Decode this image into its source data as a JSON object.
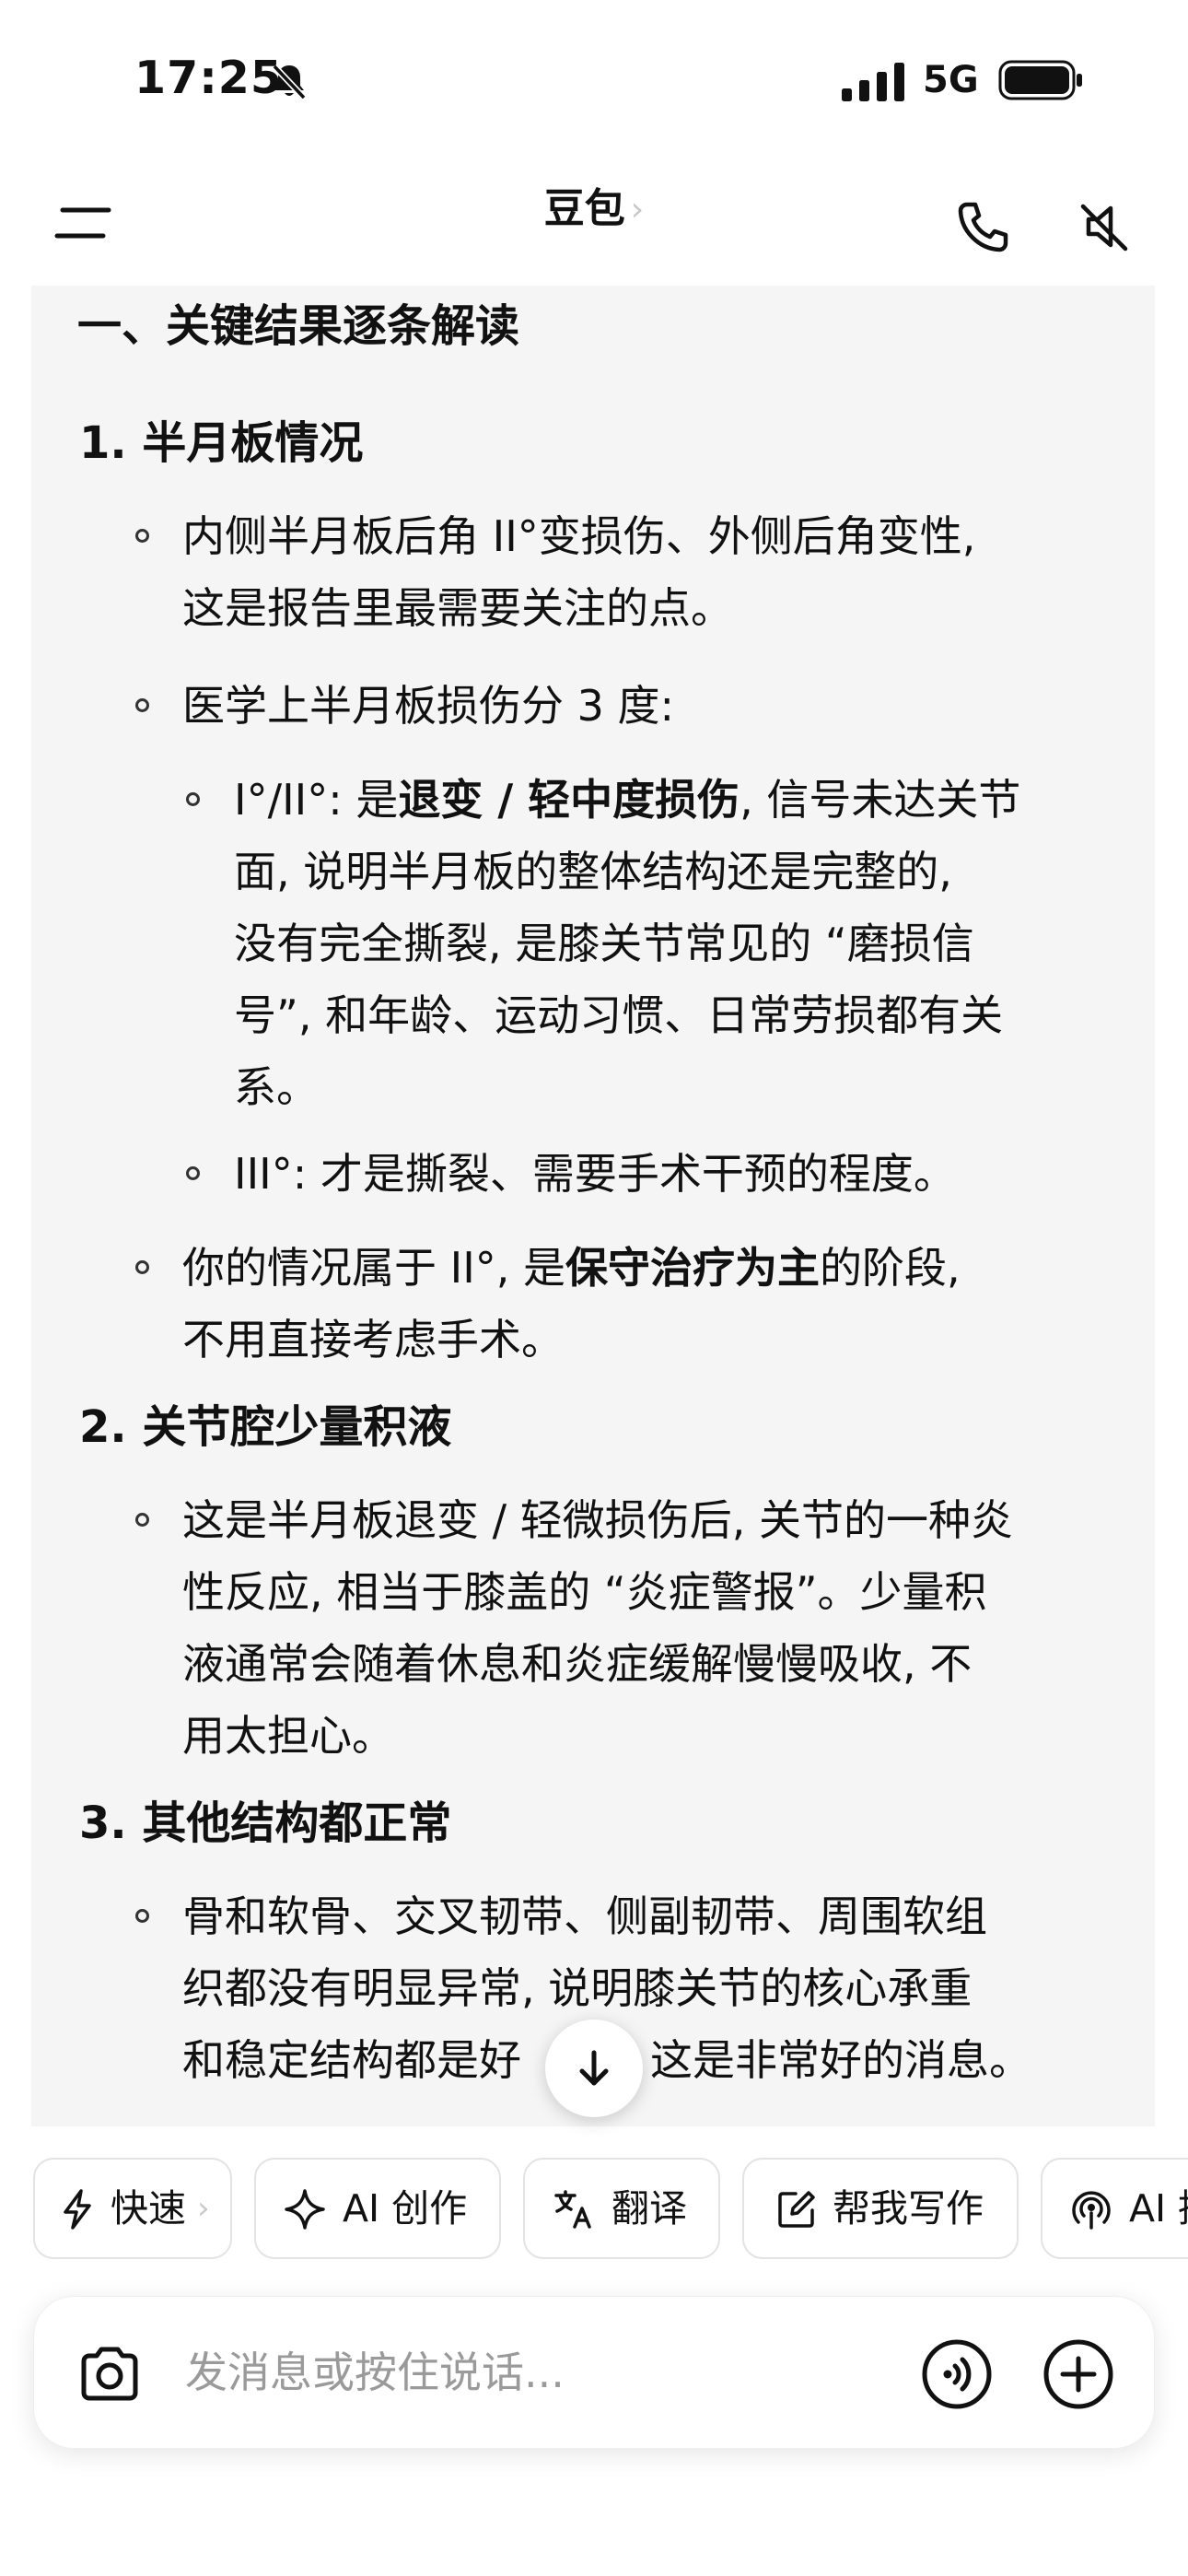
{
  "status_bar": {
    "time": "17:25",
    "network": "5G"
  },
  "header": {
    "title": "豆包",
    "title_chevron": "›"
  },
  "icons": {
    "bell_off": "bell-slash-icon",
    "signal": "cellular-signal-icon",
    "battery": "battery-icon",
    "menu": "menu-icon",
    "phone": "phone-icon",
    "mute": "speaker-mute-icon",
    "scroll_down": "arrow-down-icon",
    "camera": "camera-icon",
    "voice": "voice-call-icon",
    "plus": "plus-circle-icon"
  },
  "message": {
    "heading": "一、关键结果逐条解读",
    "s1": {
      "title": "1. 半月板情况",
      "p1_l1": "内侧半月板后角 II°变损伤、外侧后角变性,",
      "p1_l2": "这是报告里最需要关注的点。",
      "p2": "医学上半月板损伤分 3 度:",
      "sub1_l1_a": "I°/II°: 是",
      "sub1_l1_b": "退变 / 轻中度损伤",
      "sub1_l1_c": ", 信号未达关节",
      "sub1_l2": "面, 说明半月板的整体结构还是完整的,",
      "sub1_l3": "没有完全撕裂, 是膝关节常见的 “磨损信",
      "sub1_l4": "号”, 和年龄、运动习惯、日常劳损都有关",
      "sub1_l5": "系。",
      "sub2": "III°: 才是撕裂、需要手术干预的程度。",
      "p3_l1_a": "你的情况属于 II°, 是",
      "p3_l1_b": "保守治疗为主",
      "p3_l1_c": "的阶段,",
      "p3_l2": "不用直接考虑手术。"
    },
    "s2": {
      "title": "2. 关节腔少量积液",
      "l1": "这是半月板退变 / 轻微损伤后, 关节的一种炎",
      "l2": "性反应, 相当于膝盖的 “炎症警报”。少量积",
      "l3": "液通常会随着休息和炎症缓解慢慢吸收, 不",
      "l4": "用太担心。"
    },
    "s3": {
      "title": "3. 其他结构都正常",
      "l1": "骨和软骨、交叉韧带、侧副韧带、周围软组",
      "l2": "织都没有明显异常, 说明膝关节的核心承重",
      "l3_a": "和稳定结构都是好",
      "l3_b": "这是非常好的消息。"
    }
  },
  "chips": [
    {
      "label": "快速",
      "icon": "lightning-icon",
      "chevron": "›"
    },
    {
      "label": "AI 创作",
      "icon": "sparkle-icon"
    },
    {
      "label": "翻译",
      "icon": "translate-icon"
    },
    {
      "label": "帮我写作",
      "icon": "edit-icon"
    },
    {
      "label": "AI 播客",
      "icon": "podcast-icon"
    }
  ],
  "input": {
    "placeholder": "发消息或按住说话..."
  }
}
